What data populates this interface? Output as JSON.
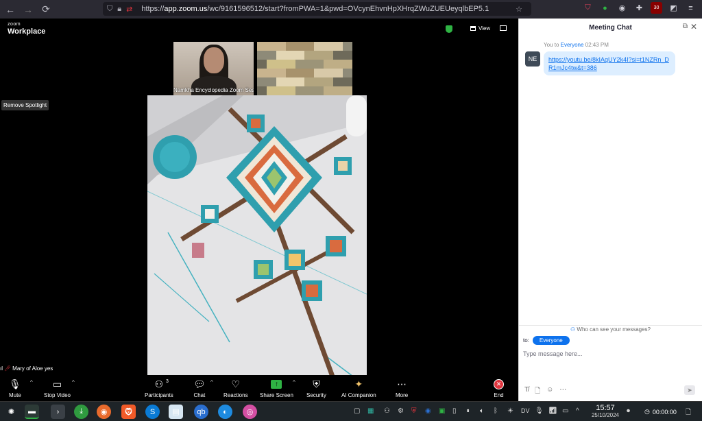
{
  "browser": {
    "url_prefix": "https://",
    "url_host": "app.zoom.us",
    "url_path": "/wc/9161596512/start?fromPWA=1&pwd=OVcynEhvnHpXHrqZWuZUEUeyqlbEP5.1",
    "ext_badge": "30"
  },
  "zoom": {
    "logo_small": "zoom",
    "logo_big": "Workplace",
    "view_label": "View",
    "spotlight_label": "Remove Spotlight",
    "thumb_name": "Namkha Encyclopedia Zoom Ses...",
    "speaker_name": "Mary of Aloe yes",
    "toolbar": {
      "mute": "Mute",
      "stop_video": "Stop Video",
      "participants": "Participants",
      "participants_count": "3",
      "chat": "Chat",
      "reactions": "Reactions",
      "share_screen": "Share Screen",
      "security": "Security",
      "ai_companion": "AI Companion",
      "more": "More",
      "end": "End"
    }
  },
  "chat": {
    "title": "Meeting Chat",
    "meta_from": "You",
    "meta_to_word": "to",
    "meta_to": "Everyone",
    "meta_time": "02:43 PM",
    "avatar_initials": "NE",
    "message_link": "https://youtu.be/8kIAqUY2k4I?si=t1NZRn_DR1mJc4tw&t=386",
    "who_can_see": "Who can see your messages?",
    "to_label": "to:",
    "to_value": "Everyone",
    "input_placeholder": "Type message here..."
  },
  "taskbar": {
    "time": "15:57",
    "date": "25/10/2024",
    "keyboard_layout": "DV",
    "rec_time": "00:00:00"
  },
  "colors": {
    "zoom_blue": "#0e72ed",
    "zoom_green": "#2fb344",
    "end_red": "#e0343d",
    "chat_bubble": "#ddeeff"
  }
}
